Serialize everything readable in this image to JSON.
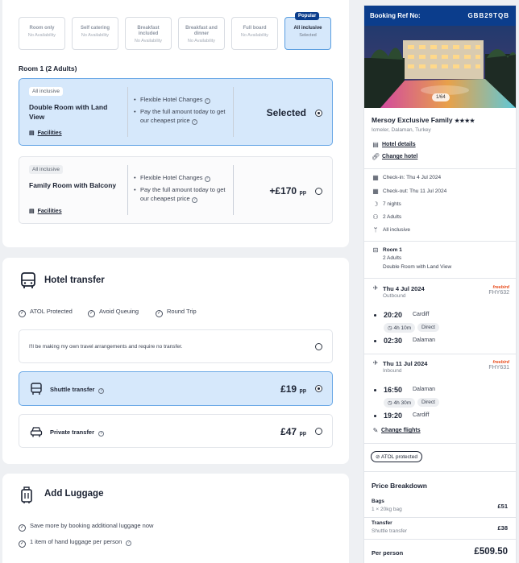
{
  "board_options": [
    {
      "title": "Room only",
      "status": "No Availability",
      "selected": false
    },
    {
      "title": "Self catering",
      "status": "No Availability",
      "selected": false
    },
    {
      "title": "Breakfast included",
      "status": "No Availability",
      "selected": false
    },
    {
      "title": "Breakfast and dinner",
      "status": "No Availability",
      "selected": false
    },
    {
      "title": "Full board",
      "status": "No Availability",
      "selected": false
    },
    {
      "title": "All inclusive",
      "status": "Selected",
      "selected": true,
      "badge": "Popular"
    }
  ],
  "room_heading": "Room 1 (2 Adults)",
  "rooms": [
    {
      "badge": "All inclusive",
      "name": "Double Room with Land View",
      "facilities": "Facilities",
      "feature1": "Flexible Hotel Changes",
      "feature2": "Pay the full amount today to get our cheapest price",
      "price": "Selected",
      "unit": "",
      "selected": true
    },
    {
      "badge": "All inclusive",
      "name": "Family Room with Balcony",
      "facilities": "Facilities",
      "feature1": "Flexible Hotel Changes",
      "feature2": "Pay the full amount today to get our cheapest price",
      "price": "+£170",
      "unit": "pp",
      "selected": false
    }
  ],
  "transfer": {
    "title": "Hotel transfer",
    "checks": [
      "ATOL Protected",
      "Avoid Queuing",
      "Round Trip"
    ],
    "none_option": "I'll be making my own travel arrangements and require no transfer.",
    "options": [
      {
        "label": "Shuttle transfer",
        "price": "£19",
        "unit": "pp",
        "selected": true
      },
      {
        "label": "Private transfer",
        "price": "£47",
        "unit": "pp",
        "selected": false
      }
    ]
  },
  "luggage": {
    "title": "Add Luggage",
    "checks": [
      "Save more by booking additional luggage now",
      "1 item of hand luggage per person"
    ]
  },
  "sidebar": {
    "ref_label": "Booking Ref No:",
    "ref": "GBB29TQB",
    "image_counter": "1/64",
    "hotel_name": "Mersoy Exclusive Family",
    "stars": "★★★★",
    "location": "Icmeler, Dalaman, Turkey",
    "hotel_details": "Hotel details",
    "change_hotel": "Change hotel",
    "check_in": "Check-in: Thu 4 Jul 2024",
    "check_out": "Check-out: Thu 11 Jul 2024",
    "nights": "7 nights",
    "adults": "2 Adults",
    "board": "All inclusive",
    "room_title": "Room 1",
    "room_adults": "2 Adults",
    "room_type": "Double Room with Land View",
    "outbound": {
      "date": "Thu 4 Jul 2024",
      "label": "Outbound",
      "flight": "FHY632",
      "airline": "freebird",
      "dep_time": "20:20",
      "dep_city": "Cardiff",
      "duration": "4h 10m",
      "stops": "Direct",
      "arr_time": "02:30",
      "arr_city": "Dalaman"
    },
    "inbound": {
      "date": "Thu 11 Jul 2024",
      "label": "Inbound",
      "flight": "FHY631",
      "airline": "freebird",
      "dep_time": "16:50",
      "dep_city": "Dalaman",
      "duration": "4h 30m",
      "stops": "Direct",
      "arr_time": "19:20",
      "arr_city": "Cardiff"
    },
    "change_flights": "Change flights",
    "atol": "ATOL protected",
    "price_breakdown": "Price Breakdown",
    "bags_label": "Bags",
    "bags_sub": "1 × 20kg bag",
    "bags_price": "£51",
    "transfer_label": "Transfer",
    "transfer_sub": "Shuttle transfer",
    "transfer_price": "£38",
    "per_person_label": "Per person",
    "per_person_price": "£509.50"
  },
  "colors": {
    "accent": "#0b3d8c",
    "selected_bg": "#d6e8fb",
    "selected_border": "#6aa8e6"
  }
}
